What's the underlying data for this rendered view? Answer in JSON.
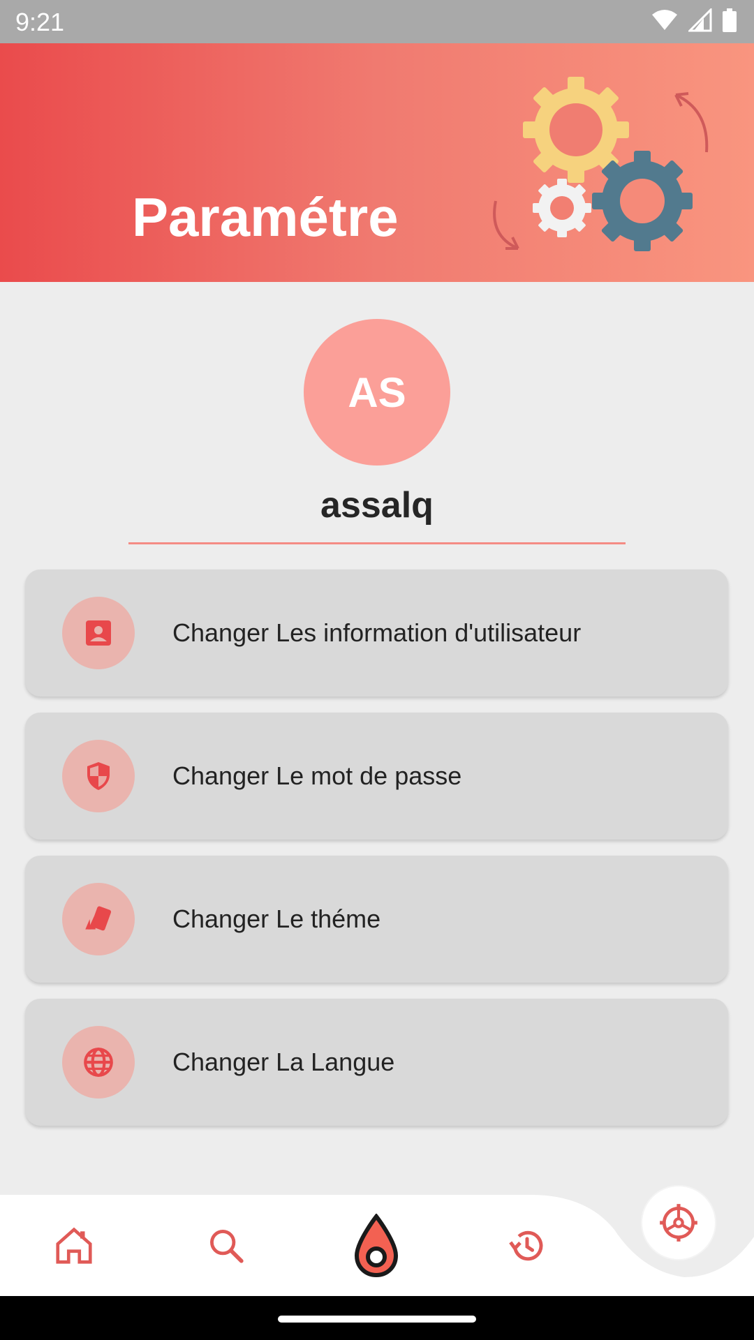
{
  "status_bar": {
    "time": "9:21",
    "icons": [
      "wifi-icon",
      "cell-signal-icon",
      "battery-icon"
    ]
  },
  "header": {
    "title": "Paramétre",
    "illustration": "gears-illustration"
  },
  "profile": {
    "initials": "AS",
    "username": "assalq"
  },
  "menu": {
    "items": [
      {
        "label": "Changer Les information d'utilisateur",
        "icon": "user-card-icon"
      },
      {
        "label": "Changer Le mot de passe",
        "icon": "shield-icon"
      },
      {
        "label": "Changer Le théme",
        "icon": "theme-swatch-icon"
      },
      {
        "label": "Changer La Langue",
        "icon": "globe-icon"
      }
    ]
  },
  "bottom_nav": {
    "items": [
      "home-icon",
      "search-icon",
      "flame-icon",
      "history-icon",
      "settings-icon"
    ],
    "active": "settings-icon"
  },
  "colors": {
    "accent": "#e8484b",
    "header_start": "#ea4b4c",
    "header_end": "#f9957f",
    "avatar": "#fb9f98",
    "card": "#d9d9d9",
    "icon_circle": "#eab4ae"
  }
}
